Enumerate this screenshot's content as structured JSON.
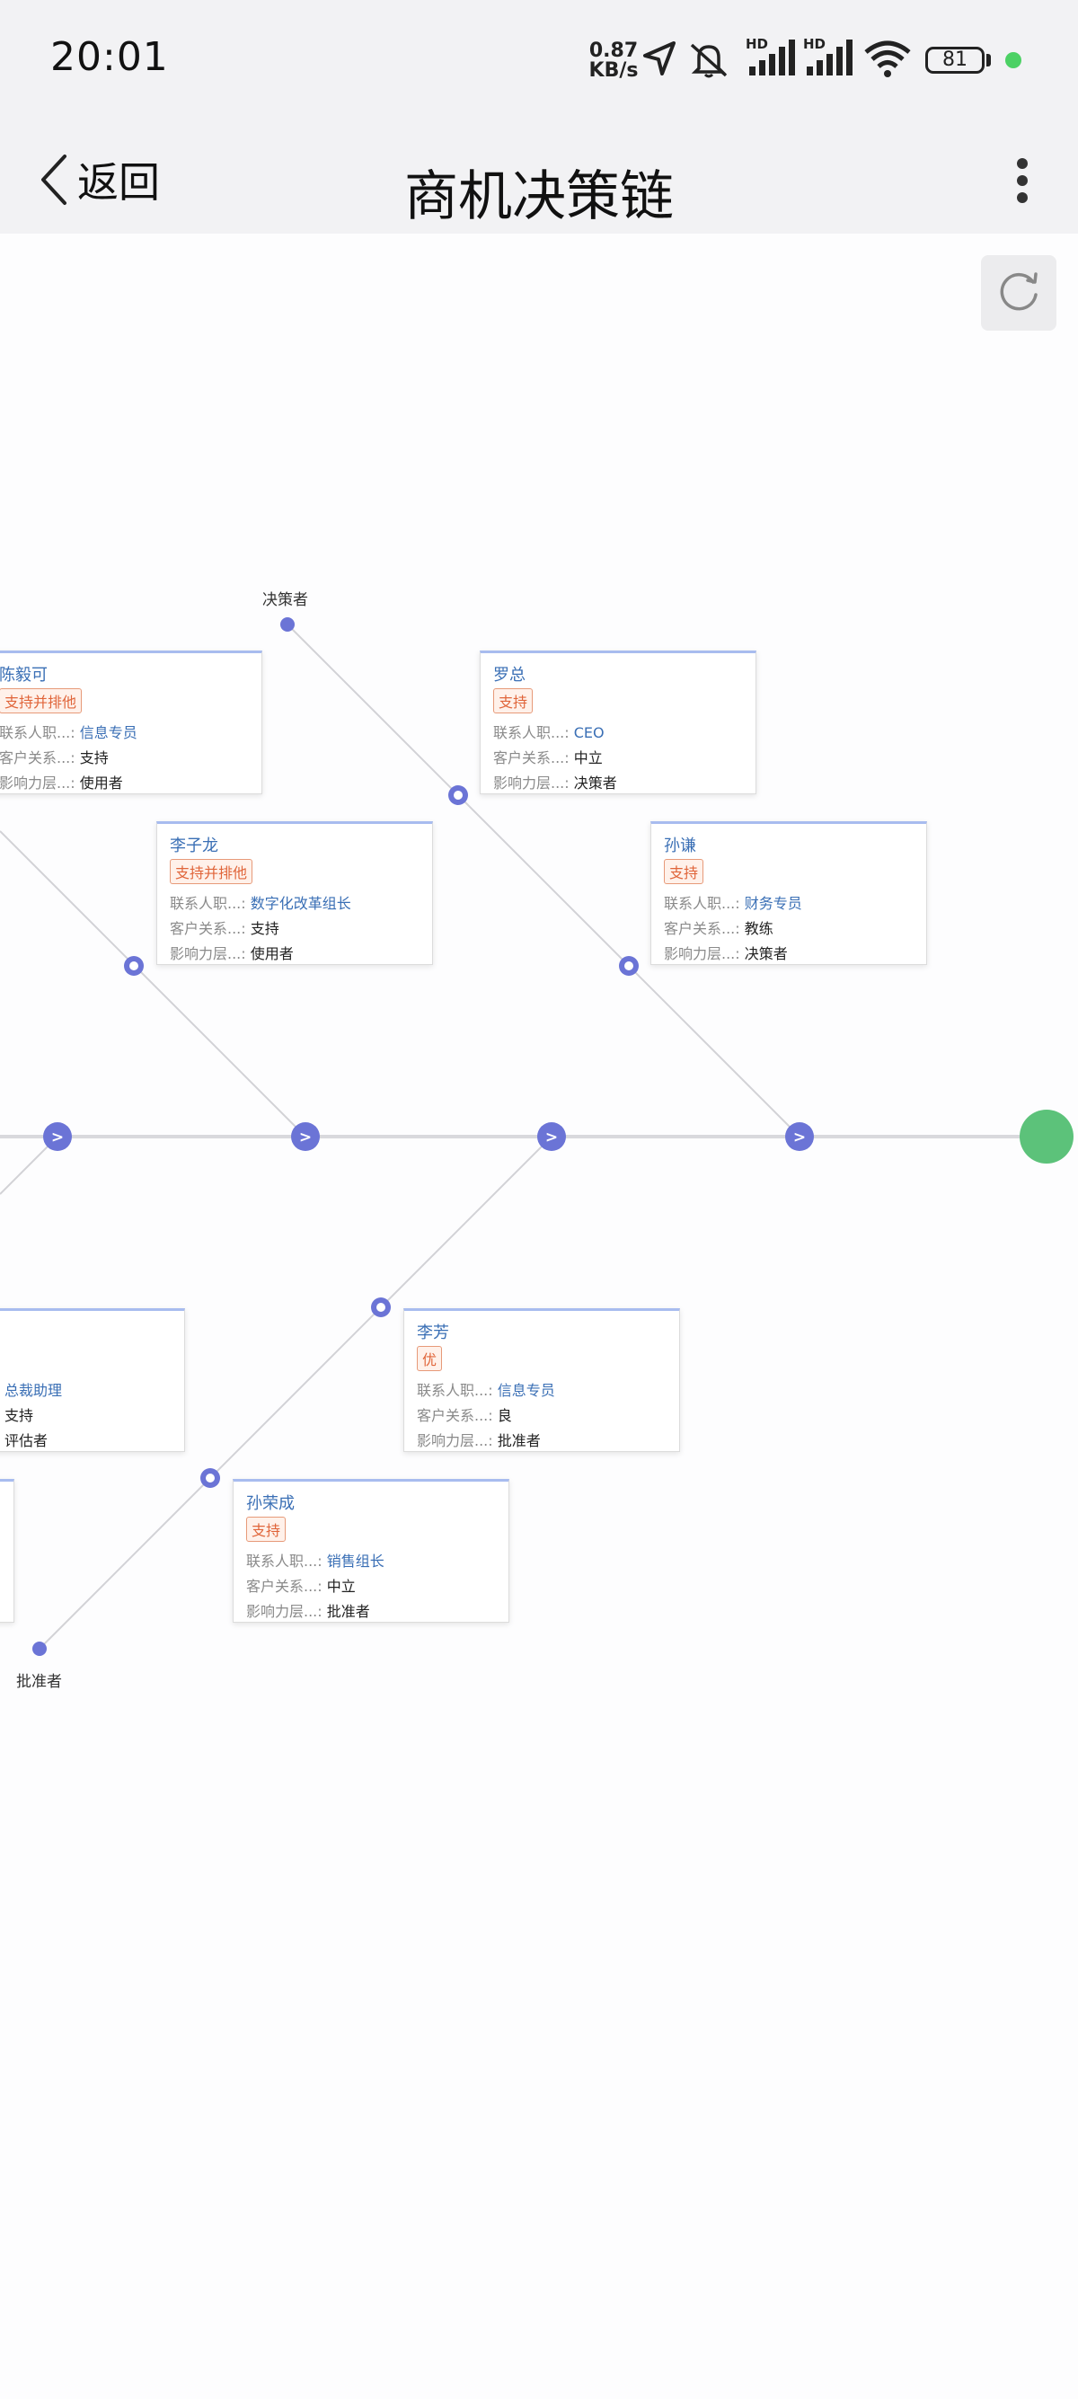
{
  "status_bar": {
    "time": "20:01",
    "net_speed_value": "0.87",
    "net_speed_unit": "KB/s",
    "battery": "81",
    "icons": [
      "location-icon",
      "mute-icon",
      "signal-hd-icon",
      "signal-hd-icon",
      "wifi-icon",
      "battery-icon"
    ]
  },
  "nav": {
    "back_label": "返回",
    "title": "商机决策链"
  },
  "diagram": {
    "top_axis_label": "决策者",
    "bottom_axis_label": "批准者",
    "accent_color": "#6b74d6",
    "end_color": "#5cc27a",
    "cards": [
      {
        "name": "陈毅可",
        "tag": "支持并排他",
        "r1_label": "联系人职...:",
        "r1_value": "信息专员",
        "r2_label": "客户关系...:",
        "r2_value": "支持",
        "r3_label": "影响力层...:",
        "r3_value": "使用者"
      },
      {
        "name": "罗总",
        "tag": "支持",
        "r1_label": "联系人职...:",
        "r1_value": "CEO",
        "r2_label": "客户关系...:",
        "r2_value": "中立",
        "r3_label": "影响力层...:",
        "r3_value": "决策者"
      },
      {
        "name": "李子龙",
        "tag": "支持并排他",
        "r1_label": "联系人职...:",
        "r1_value": "数字化改革组长",
        "r2_label": "客户关系...:",
        "r2_value": "支持",
        "r3_label": "影响力层...:",
        "r3_value": "使用者"
      },
      {
        "name": "孙谦",
        "tag": "支持",
        "r1_label": "联系人职...:",
        "r1_value": "财务专员",
        "r2_label": "客户关系...:",
        "r2_value": "教练",
        "r3_label": "影响力层...:",
        "r3_value": "决策者"
      },
      {
        "name": "",
        "tag": "",
        "r1_label": "",
        "r1_value": "总裁助理",
        "r2_label": "",
        "r2_value": "支持",
        "r3_label": "",
        "r3_value": "评估者"
      },
      {
        "name": "李芳",
        "tag": "优",
        "r1_label": "联系人职...:",
        "r1_value": "信息专员",
        "r2_label": "客户关系...:",
        "r2_value": "良",
        "r3_label": "影响力层...:",
        "r3_value": "批准者"
      },
      {
        "name": "孙荣成",
        "tag": "支持",
        "r1_label": "联系人职...:",
        "r1_value": "销售组长",
        "r2_label": "客户关系...:",
        "r2_value": "中立",
        "r3_label": "影响力层...:",
        "r3_value": "批准者"
      }
    ],
    "arrow_glyph": ">"
  }
}
